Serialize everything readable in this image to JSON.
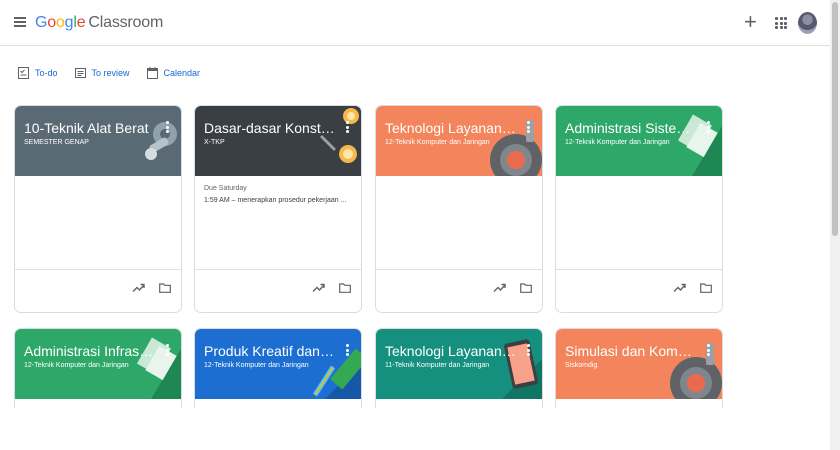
{
  "header": {
    "logo_google": "Google",
    "logo_product": "Classroom",
    "add_symbol": "+"
  },
  "quick_links": [
    {
      "label": "To-do",
      "icon": "todo-icon"
    },
    {
      "label": "To review",
      "icon": "review-icon"
    },
    {
      "label": "Calendar",
      "icon": "calendar-icon"
    }
  ],
  "colors": {
    "slate": "#5a6a75",
    "dark": "#3a3f45",
    "orange": "#f3845c",
    "green": "#2ea868",
    "blue": "#1c6fd1",
    "teal": "#15907e",
    "link": "#1967d2"
  },
  "classes": [
    {
      "title": "10-Teknik Alat Berat",
      "subtitle": "SEMESTER GENAP",
      "color": "slate",
      "illustration": "gears"
    },
    {
      "title": "Dasar-dasar Konstruksi",
      "subtitle": "X-TKP",
      "color": "dark",
      "illustration": "lightbulb",
      "due": "Due Saturday",
      "assignment": "1:59 AM – menerapkan prosedur pekerjaan ..."
    },
    {
      "title": "Teknologi Layanan Jaringan",
      "subtitle": "12-Teknik Komputer dan Jaringan",
      "color": "orange",
      "illustration": "record"
    },
    {
      "title": "Administrasi Sistem Jaringan",
      "subtitle": "12-Teknik Komputer dan Jaringan",
      "color": "green",
      "illustration": "papers"
    },
    {
      "title": "Administrasi Infrastruktur Jaringan",
      "subtitle": "12-Teknik Komputer dan Jaringan",
      "color": "green",
      "illustration": "papers"
    },
    {
      "title": "Produk Kreatif dan Kewirausahaan",
      "subtitle": "12-Teknik Komputer dan Jaringan",
      "color": "blue",
      "illustration": "pencil"
    },
    {
      "title": "Teknologi Layanan Jaringan",
      "subtitle": "11-Teknik Komputer dan Jaringan",
      "color": "teal",
      "illustration": "phone"
    },
    {
      "title": "Simulasi dan Komunikasi Digital",
      "subtitle": "Siskomdig",
      "color": "orange",
      "illustration": "record"
    }
  ]
}
